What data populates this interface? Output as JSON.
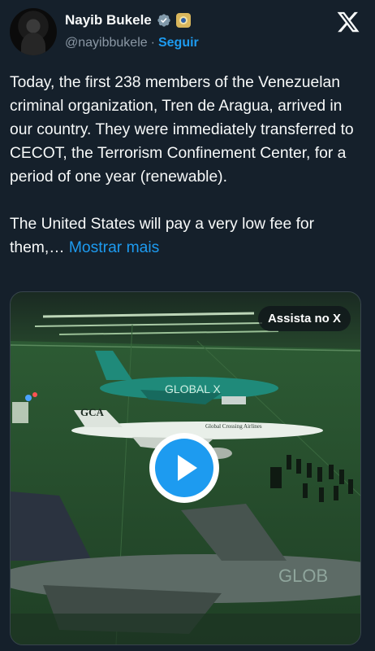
{
  "author": {
    "name": "Nayib Bukele",
    "handle": "@nayibbukele",
    "separator": "·",
    "follow_label": "Seguir"
  },
  "icons": {
    "verified": "verified-badge-icon",
    "affiliation": "government-seal-icon",
    "platform": "x-logo-icon",
    "play": "play-icon"
  },
  "tweet": {
    "text": "Today, the first 238 members of the Venezuelan criminal organization, Tren de Aragua, arrived in our country. They were immediately transferred to CECOT, the Terrorism Confinement Center, for a period of one year (renewable).\n\nThe United States will pay a very low fee for them,… ",
    "show_more_label": "Mostrar mais"
  },
  "media": {
    "watch_label": "Assista no X",
    "plane_labels": {
      "global_livery": "GLOBAL X",
      "gca_tail": "GCA",
      "gca_fuselage": "Global Crossing Airlines",
      "foreground_livery": "GLOB"
    }
  },
  "colors": {
    "background": "#15202b",
    "accent": "#1d9bf0",
    "text": "#f7f9f9",
    "secondary_text": "#8b98a5"
  }
}
